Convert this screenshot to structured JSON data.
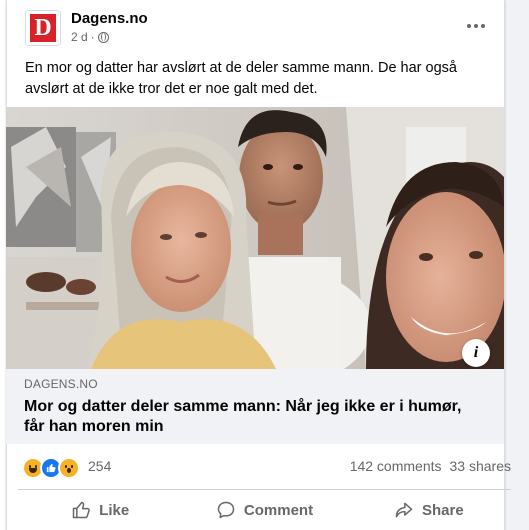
{
  "post": {
    "page_name": "Dagens.no",
    "logo_letter": "D",
    "time": "2 d",
    "separator": "·",
    "more_icon": "ellipsis-icon",
    "text": "En mor og datter har avslørt at de deler samme mann. De har også avslørt at de ikke tror det er noe galt med det."
  },
  "media": {
    "info_label": "i"
  },
  "link": {
    "domain": "DAGENS.NO",
    "title": "Mor og datter deler samme mann: Når jeg ikke er i humør, får han moren min"
  },
  "engagement": {
    "reactions": [
      "haha",
      "like",
      "wow"
    ],
    "reaction_count": "254",
    "comments": "142 comments",
    "shares": "33 shares"
  },
  "actions": {
    "like": "Like",
    "comment": "Comment",
    "share": "Share"
  },
  "colors": {
    "brand_red": "#d8222a",
    "like_blue": "#1877f2",
    "secondary_text": "#65676b",
    "link_box_bg": "#f0f2f5"
  }
}
